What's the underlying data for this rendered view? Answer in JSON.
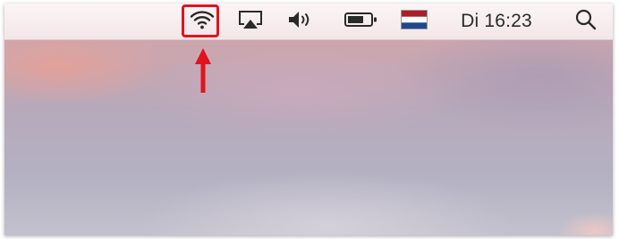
{
  "menubar": {
    "items": [
      {
        "name": "wifi",
        "icon": "wifi-icon"
      },
      {
        "name": "airplay",
        "icon": "airplay-icon"
      },
      {
        "name": "volume",
        "icon": "volume-icon"
      },
      {
        "name": "battery",
        "icon": "battery-icon"
      },
      {
        "name": "input-source",
        "icon": "dutch-flag-icon"
      },
      {
        "name": "clock",
        "icon": null
      },
      {
        "name": "spotlight",
        "icon": "search-icon"
      }
    ],
    "clock_text": "Di 16:23"
  },
  "annotation": {
    "highlight_color": "#e0141e",
    "highlight_target": "wifi-icon",
    "arrow": "arrow-up-icon"
  },
  "colors": {
    "flag_red": "#ae1c28",
    "flag_white": "#ffffff",
    "flag_blue": "#21468b",
    "icon_color": "#2a2a2a"
  }
}
